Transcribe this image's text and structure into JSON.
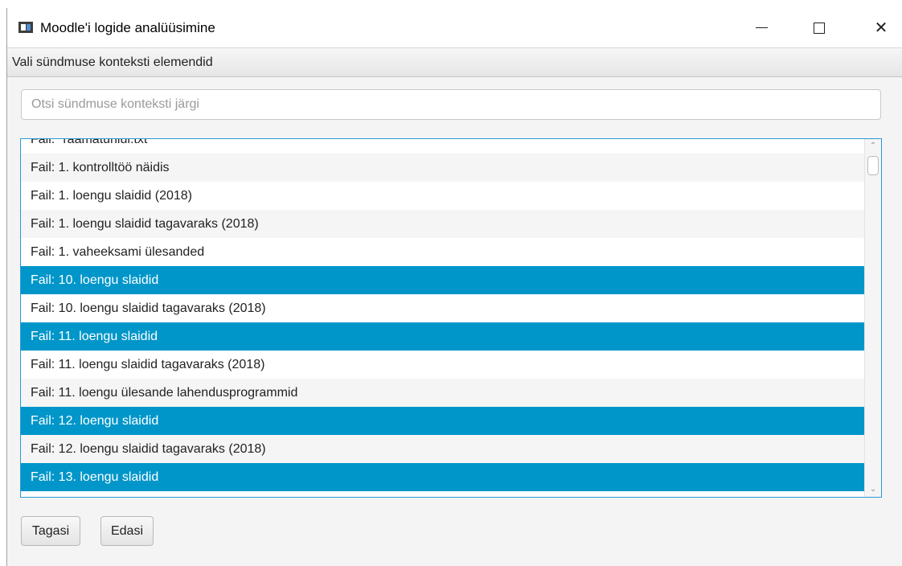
{
  "window": {
    "title": "Moodle'i logide analüüsimine",
    "controls": {
      "minimize": "—",
      "maximize": "☐",
      "close": "✕"
    }
  },
  "menubar": {
    "label": "Vali sündmuse konteksti elemendid"
  },
  "search": {
    "placeholder": "Otsi sündmuse konteksti järgi",
    "value": ""
  },
  "list": {
    "items": [
      {
        "label": "Fail: \"raamaturiiul.txt\"",
        "selected": false
      },
      {
        "label": "Fail: 1. kontrolltöö näidis",
        "selected": false
      },
      {
        "label": "Fail: 1. loengu slaidid (2018)",
        "selected": false
      },
      {
        "label": "Fail: 1. loengu slaidid tagavaraks (2018)",
        "selected": false
      },
      {
        "label": "Fail: 1. vaheeksami ülesanded",
        "selected": false
      },
      {
        "label": "Fail: 10. loengu slaidid",
        "selected": true
      },
      {
        "label": "Fail: 10. loengu slaidid tagavaraks (2018)",
        "selected": false
      },
      {
        "label": "Fail: 11. loengu slaidid",
        "selected": true
      },
      {
        "label": "Fail: 11. loengu slaidid tagavaraks (2018)",
        "selected": false
      },
      {
        "label": "Fail: 11. loengu ülesande lahendusprogrammid",
        "selected": false
      },
      {
        "label": "Fail: 12. loengu slaidid",
        "selected": true
      },
      {
        "label": "Fail: 12. loengu slaidid tagavaraks (2018)",
        "selected": false
      },
      {
        "label": "Fail: 13. loengu slaidid",
        "selected": true
      }
    ]
  },
  "buttons": {
    "back": "Tagasi",
    "next": "Edasi"
  },
  "colors": {
    "selection": "#0096c9",
    "focus_border": "#2a9ad6"
  },
  "icons": [
    "app-icon",
    "minimize-icon",
    "maximize-icon",
    "close-icon",
    "scroll-up-icon",
    "scroll-down-icon"
  ]
}
